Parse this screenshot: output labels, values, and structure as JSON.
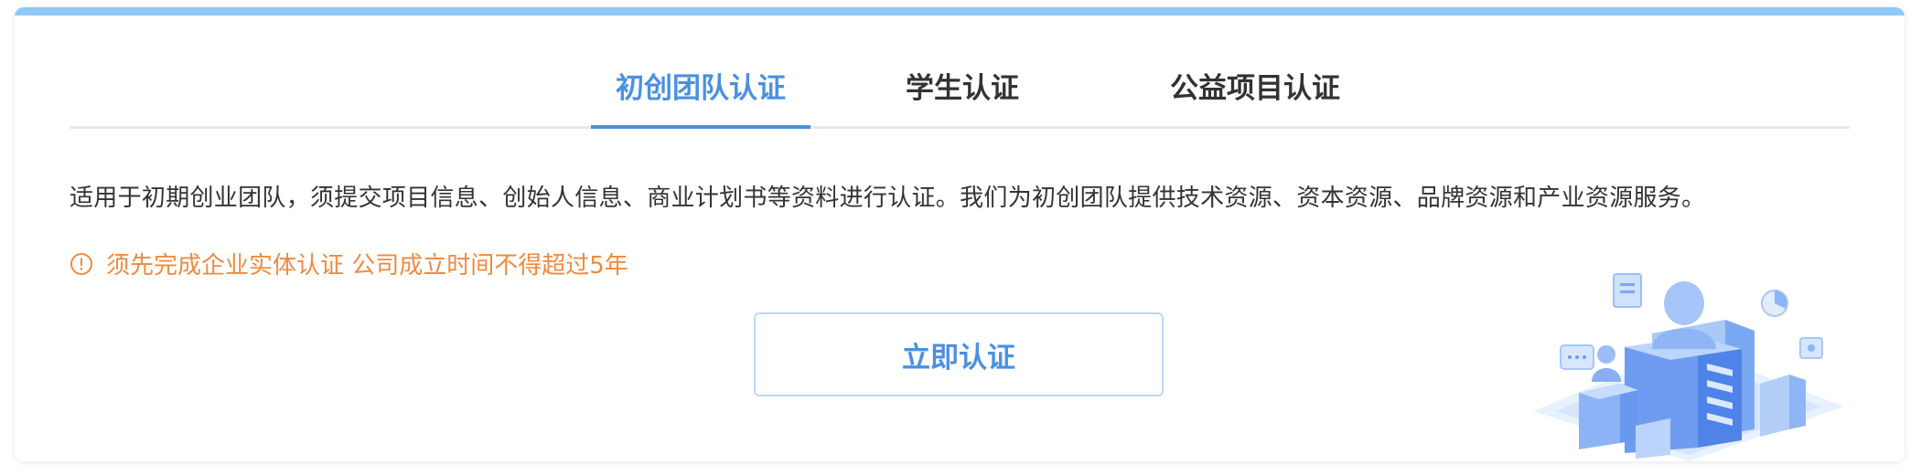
{
  "tabs": [
    {
      "label": "初创团队认证",
      "active": true
    },
    {
      "label": "学生认证",
      "active": false
    },
    {
      "label": "公益项目认证",
      "active": false
    }
  ],
  "content": {
    "description": "适用于初期创业团队，须提交项目信息、创始人信息、商业计划书等资料进行认证。我们为初创团队提供技术资源、资本资源、品牌资源和产业资源服务。",
    "notice_icon": "info-circle-icon",
    "notice": "须先完成企业实体认证 公司成立时间不得超过5年",
    "button_label": "立即认证"
  },
  "colors": {
    "accent": "#4a90e2",
    "top_bar": "#90c8f8",
    "warning": "#f08a3e",
    "text": "#333333",
    "button_border": "#bcd8f7"
  },
  "illustration": "team-building-illustration"
}
